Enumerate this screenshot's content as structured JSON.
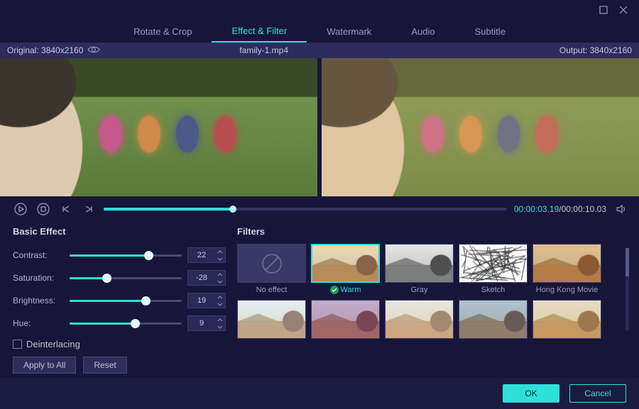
{
  "titlebar": {
    "window_icons": [
      "maximize",
      "close"
    ]
  },
  "tabs": {
    "items": [
      {
        "label": "Rotate & Crop"
      },
      {
        "label": "Effect & Filter",
        "active": true
      },
      {
        "label": "Watermark"
      },
      {
        "label": "Audio"
      },
      {
        "label": "Subtitle"
      }
    ]
  },
  "infobar": {
    "original_label": "Original: 3840x2160",
    "filename": "family-1.mp4",
    "output_label": "Output: 3840x2160"
  },
  "playback": {
    "current_time": "00:00:03.19",
    "total_time": "00:00:10.03",
    "progress_pct": 32
  },
  "basic_effect": {
    "title": "Basic Effect",
    "controls": [
      {
        "label": "Contrast:",
        "value": 22,
        "pct": 70
      },
      {
        "label": "Saturation:",
        "value": -28,
        "pct": 33
      },
      {
        "label": "Brightness:",
        "value": 19,
        "pct": 68
      },
      {
        "label": "Hue:",
        "value": 9,
        "pct": 58
      }
    ],
    "deinterlacing_label": "Deinterlacing",
    "apply_all_label": "Apply to All",
    "reset_label": "Reset"
  },
  "filters": {
    "title": "Filters",
    "items": [
      {
        "label": "No effect",
        "kind": "none"
      },
      {
        "label": "Warm",
        "kind": "warm",
        "selected": true
      },
      {
        "label": "Gray",
        "kind": "gray"
      },
      {
        "label": "Sketch",
        "kind": "sketch"
      },
      {
        "label": "Hong Kong Movie",
        "kind": "hk"
      },
      {
        "label": "",
        "kind": "f1"
      },
      {
        "label": "",
        "kind": "f2"
      },
      {
        "label": "",
        "kind": "f3"
      },
      {
        "label": "",
        "kind": "f4"
      },
      {
        "label": "",
        "kind": "f5"
      }
    ]
  },
  "footer": {
    "ok_label": "OK",
    "cancel_label": "Cancel"
  }
}
